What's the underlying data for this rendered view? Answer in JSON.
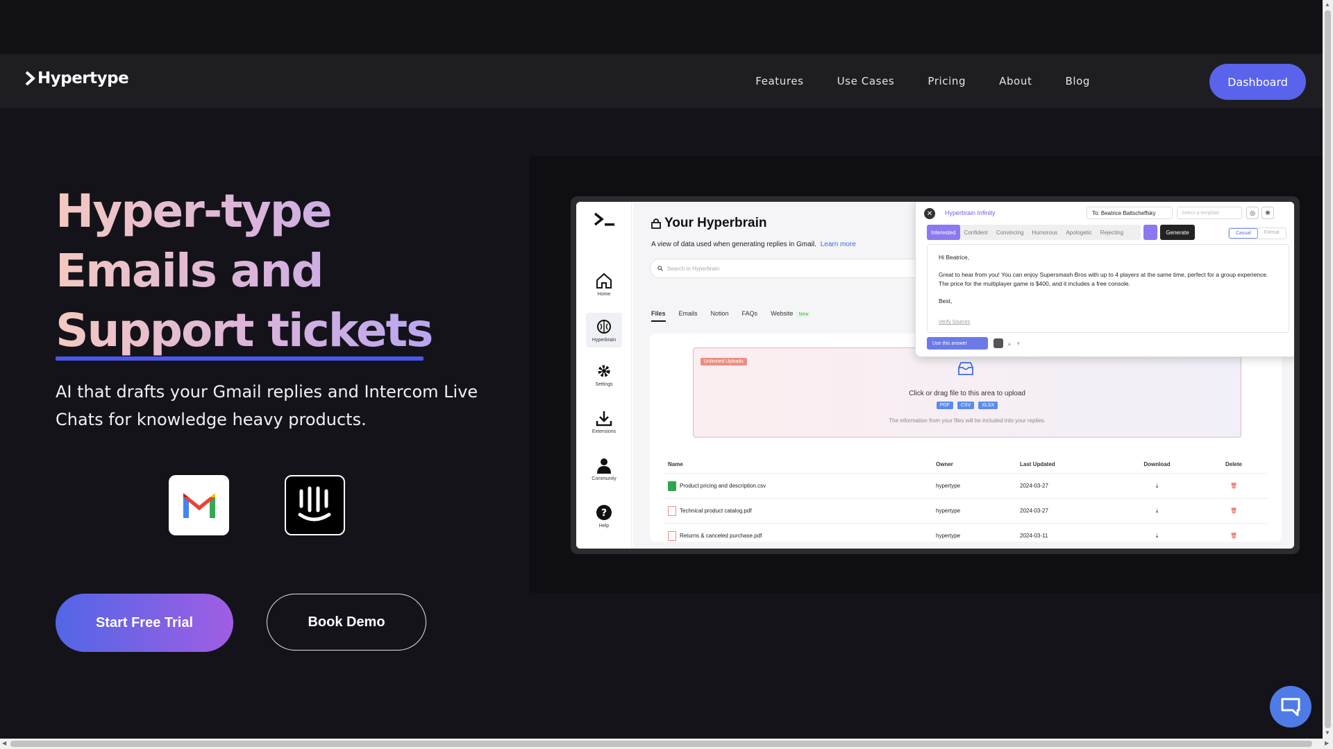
{
  "nav": {
    "logo_text": "Hypertype",
    "links": [
      "Features",
      "Use Cases",
      "Pricing",
      "About",
      "Blog"
    ],
    "dashboard_label": "Dashboard"
  },
  "hero": {
    "title_lines": [
      "Hyper-type",
      "Emails and",
      "Support tickets"
    ],
    "subtitle": "AI that drafts your Gmail replies and Intercom Live Chats for knowledge heavy products.",
    "primary_cta": "Start Free Trial",
    "secondary_cta": "Book Demo",
    "integrations": [
      "gmail-icon",
      "intercom-icon"
    ]
  },
  "mock": {
    "sidebar": [
      "Home",
      "Hyperbrain",
      "Settings",
      "Extensions",
      "Community",
      "Help"
    ],
    "title": "Your Hyperbrain",
    "description": "A view of data used when generating replies in Gmail.",
    "learn_more": "Learn more",
    "search_placeholder": "Search in Hyperbrain",
    "tabs": [
      "Files",
      "Emails",
      "Notion",
      "FAQs",
      "Website"
    ],
    "new_badge": "New",
    "upload": {
      "badge": "Unlimited Uploads",
      "prompt": "Click or drag file to this area to upload",
      "chips": [
        "PDF",
        "CSV",
        "XLSX"
      ],
      "note": "The information from your files will be included into your replies."
    },
    "table": {
      "headers": [
        "Name",
        "Owner",
        "Last Updated",
        "Download",
        "Delete"
      ],
      "rows": [
        {
          "name": "Product pricing and description.csv",
          "owner": "hypertype",
          "updated": "2024-03-27",
          "type": "csv"
        },
        {
          "name": "Technical product catalog.pdf",
          "owner": "hypertype",
          "updated": "2024-03-27",
          "type": "pdf"
        },
        {
          "name": "Returns & canceled purchase.pdf",
          "owner": "hypertype",
          "updated": "2024-03-11",
          "type": "pdf"
        }
      ]
    },
    "popup": {
      "title": "Hyperbrain Infinity",
      "to": "To: Beatrice Baltscheffsky",
      "template_placeholder": "Select a template",
      "tones": [
        "Interested",
        "Confident",
        "Convincing",
        "Humorous",
        "Apologetic",
        "Rejecting"
      ],
      "active_tone": "Interested",
      "generate": "Generate",
      "styles": [
        "Casual",
        "Formal"
      ],
      "body": [
        "Hi Beatrice,",
        "Great to hear from you! You can enjoy Supersmash Bros with up to 4 players at the same time, perfect for a group experience. The price for the multiplayer game is $400, and it includes a free console.",
        "Best,"
      ],
      "verify": "Verify Sources",
      "use_answer": "Use this answer"
    }
  },
  "colors": {
    "page_bg": "#14131a",
    "accent": "#5a63ec",
    "underline": "#4b57ea"
  }
}
